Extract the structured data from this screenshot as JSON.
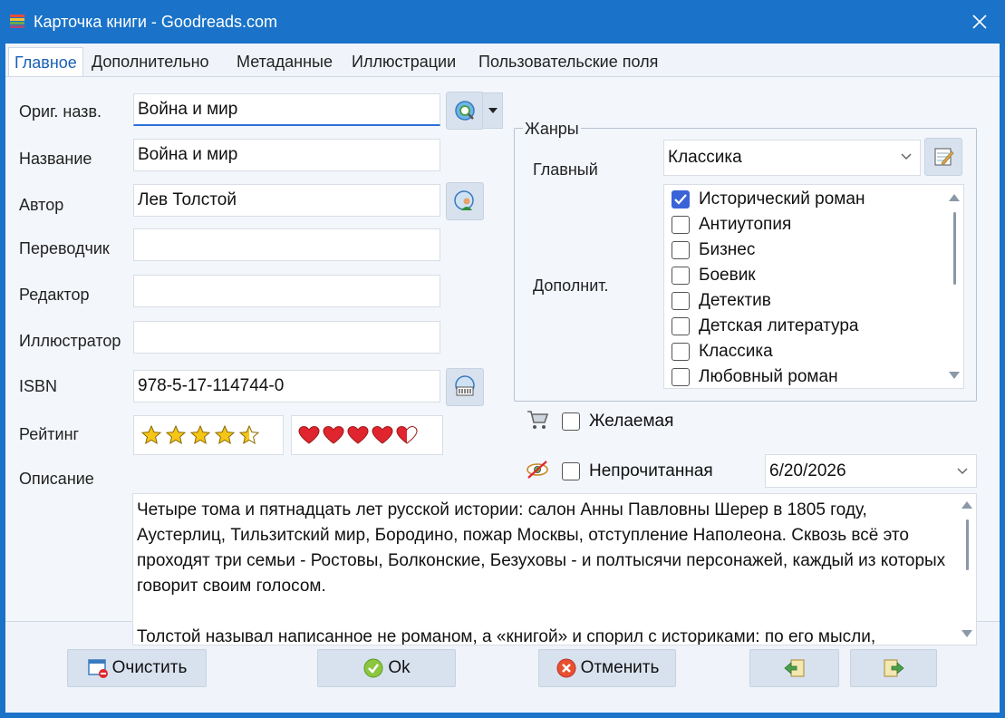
{
  "window": {
    "title": "Карточка книги - Goodreads.com"
  },
  "tabs": [
    {
      "label": "Главное",
      "active": true
    },
    {
      "label": "Дополнительно"
    },
    {
      "label": "Метаданные"
    },
    {
      "label": "Иллюстрации"
    },
    {
      "label": "Пользовательские поля"
    }
  ],
  "fields": {
    "orig_title": {
      "label": "Ориг. назв.",
      "value": "Война и мир"
    },
    "title": {
      "label": "Название",
      "value": "Война и мир"
    },
    "author": {
      "label": "Автор",
      "value": "Лев Толстой"
    },
    "translator": {
      "label": "Переводчик",
      "value": ""
    },
    "editor": {
      "label": "Редактор",
      "value": ""
    },
    "illustrator": {
      "label": "Иллюстратор",
      "value": ""
    },
    "isbn": {
      "label": "ISBN",
      "value": "978-5-17-114744-0"
    },
    "rating": {
      "label": "Рейтинг",
      "stars": 4.5,
      "hearts": 4.5,
      "max": 5
    },
    "description": {
      "label": "Описание",
      "value": "Четыре тома и пятнадцать лет русской истории: салон Анны Павловны Шерер в 1805 году, Аустерлиц, Тильзитский мир, Бородино, пожар Москвы, отступление Наполеона. Сквозь всё это проходят три семьи - Ростовы, Болконские, Безуховы - и полтысячи персонажей, каждый из которых говорит своим голосом.\n\nТолстой называл написанное не романом, а «книгой» и спорил с историками: по его мысли,"
    }
  },
  "genres": {
    "legend": "Жанры",
    "main_label": "Главный",
    "main_value": "Классика",
    "extra_label": "Дополнит.",
    "items": [
      {
        "label": "Исторический роман",
        "checked": true
      },
      {
        "label": "Антиутопия",
        "checked": false
      },
      {
        "label": "Бизнес",
        "checked": false
      },
      {
        "label": "Боевик",
        "checked": false
      },
      {
        "label": "Детектив",
        "checked": false
      },
      {
        "label": "Детская литература",
        "checked": false
      },
      {
        "label": "Классика",
        "checked": false
      },
      {
        "label": "Любовный роман",
        "checked": false
      }
    ]
  },
  "flags": {
    "wished": {
      "label": "Желаемая",
      "checked": false
    },
    "unread": {
      "label": "Непрочитанная",
      "checked": false
    },
    "date": "6/20/2026"
  },
  "buttons": {
    "clear": "Очистить",
    "ok": "Ok",
    "cancel": "Отменить"
  },
  "colors": {
    "accent": "#1a73c9",
    "star": "#f5c518",
    "heart": "#e0252f"
  }
}
